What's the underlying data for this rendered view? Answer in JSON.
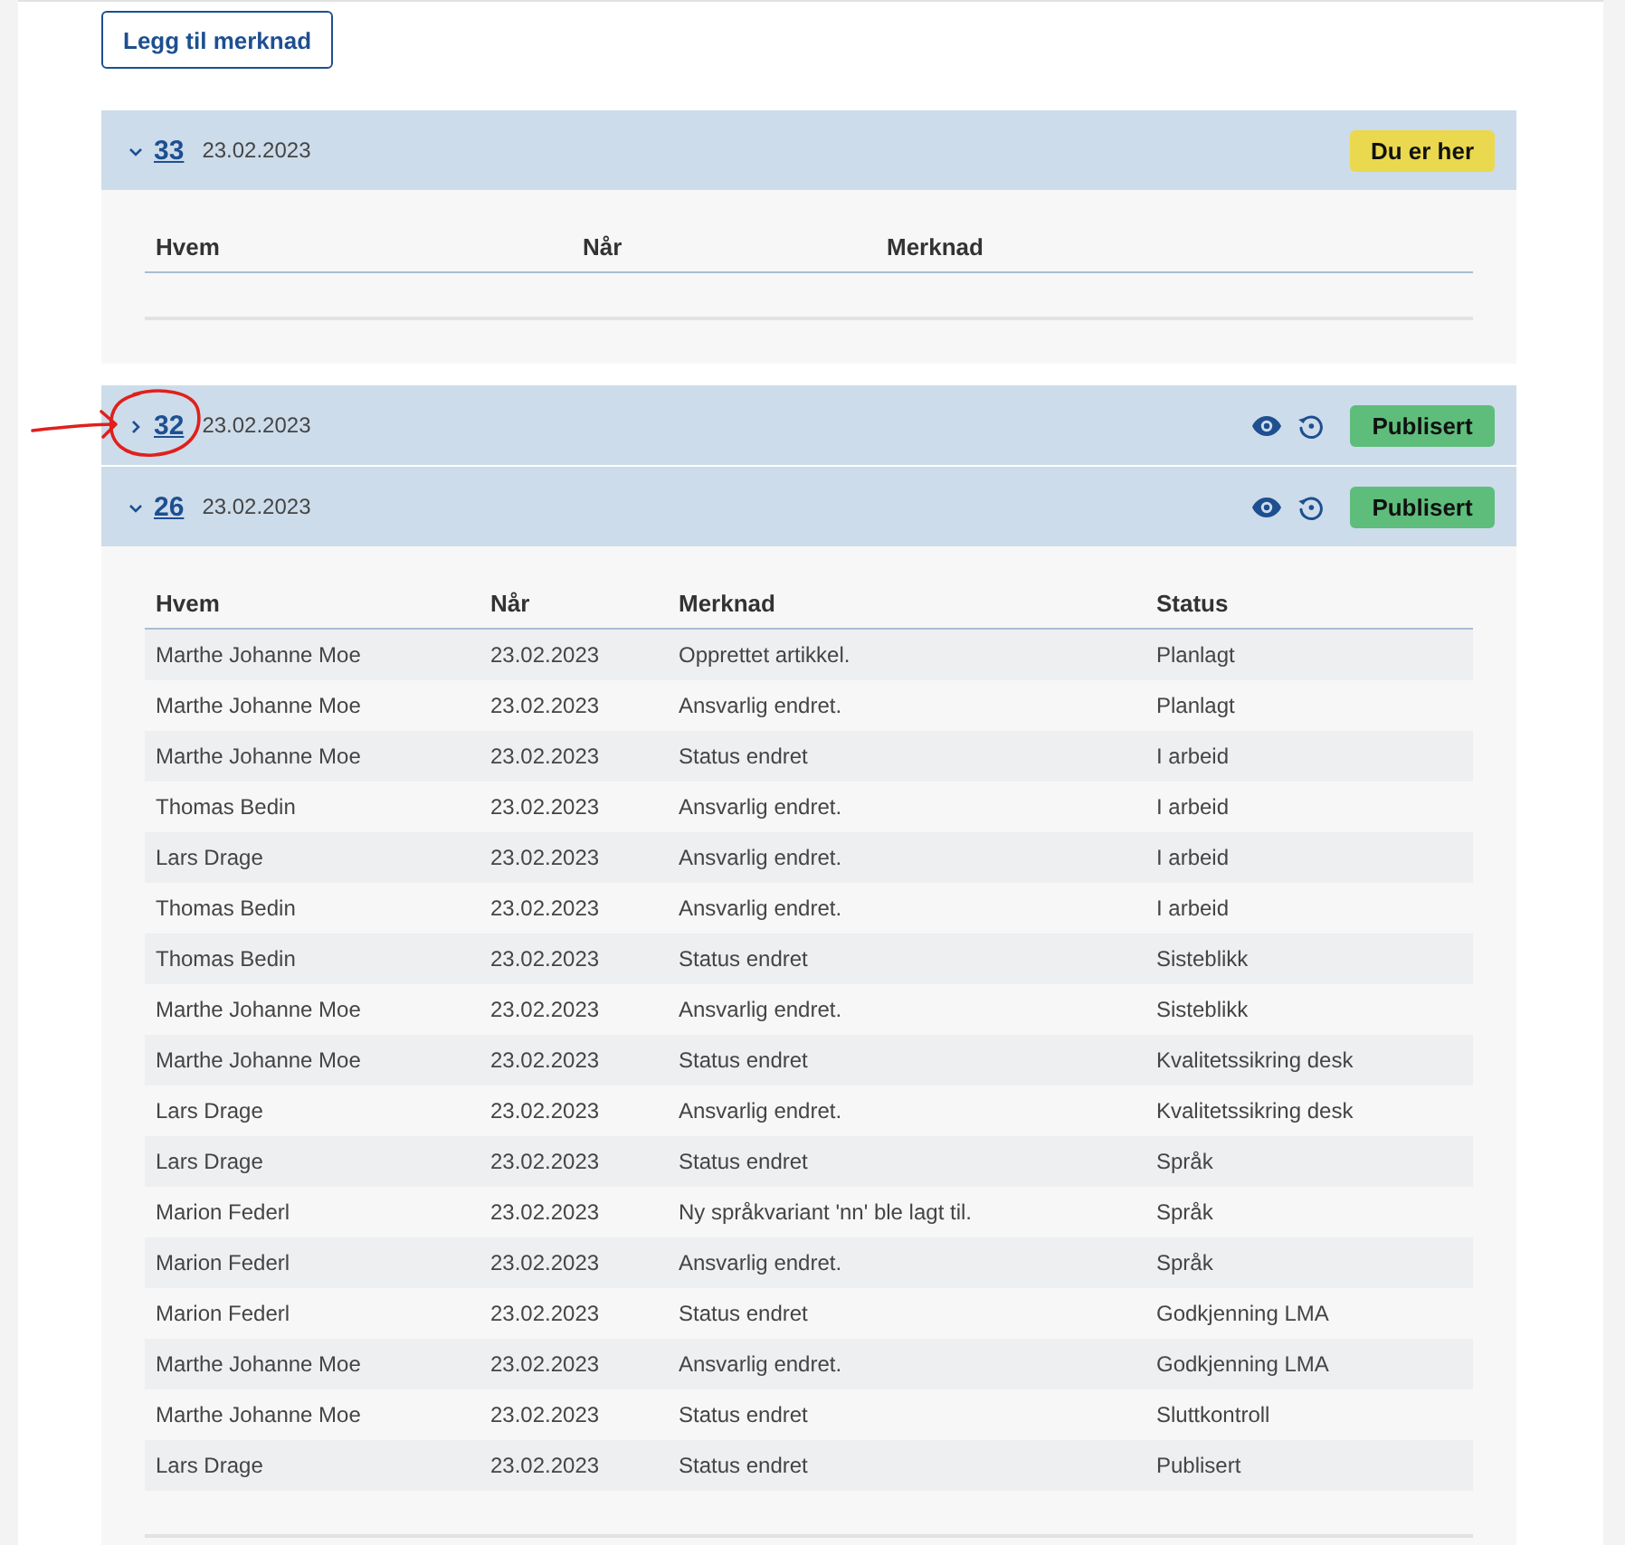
{
  "add_note_button": {
    "label": "Legg til merknad"
  },
  "versions": [
    {
      "number": "33",
      "date": "23.02.2023",
      "expanded": true,
      "annotated": false,
      "show_actions": false,
      "badge": {
        "kind": "current",
        "label": "Du er her"
      },
      "table": {
        "columns": [
          "Hvem",
          "Når",
          "Merknad"
        ]
      }
    },
    {
      "number": "32",
      "date": "23.02.2023",
      "expanded": false,
      "annotated": true,
      "show_actions": true,
      "badge": {
        "kind": "published",
        "label": "Publisert"
      }
    },
    {
      "number": "26",
      "date": "23.02.2023",
      "expanded": true,
      "annotated": false,
      "show_actions": true,
      "badge": {
        "kind": "published",
        "label": "Publisert"
      },
      "table": {
        "columns": [
          "Hvem",
          "Når",
          "Merknad",
          "Status"
        ],
        "rows": [
          [
            "Marthe Johanne Moe",
            "23.02.2023",
            "Opprettet artikkel.",
            "Planlagt"
          ],
          [
            "Marthe Johanne Moe",
            "23.02.2023",
            "Ansvarlig endret.",
            "Planlagt"
          ],
          [
            "Marthe Johanne Moe",
            "23.02.2023",
            "Status endret",
            "I arbeid"
          ],
          [
            "Thomas Bedin",
            "23.02.2023",
            "Ansvarlig endret.",
            "I arbeid"
          ],
          [
            "Lars Drage",
            "23.02.2023",
            "Ansvarlig endret.",
            "I arbeid"
          ],
          [
            "Thomas Bedin",
            "23.02.2023",
            "Ansvarlig endret.",
            "I arbeid"
          ],
          [
            "Thomas Bedin",
            "23.02.2023",
            "Status endret",
            "Sisteblikk"
          ],
          [
            "Marthe Johanne Moe",
            "23.02.2023",
            "Ansvarlig endret.",
            "Sisteblikk"
          ],
          [
            "Marthe Johanne Moe",
            "23.02.2023",
            "Status endret",
            "Kvalitetssikring desk"
          ],
          [
            "Lars Drage",
            "23.02.2023",
            "Ansvarlig endret.",
            "Kvalitetssikring desk"
          ],
          [
            "Lars Drage",
            "23.02.2023",
            "Status endret",
            "Språk"
          ],
          [
            "Marion Federl",
            "23.02.2023",
            "Ny språkvariant 'nn' ble lagt til.",
            "Språk"
          ],
          [
            "Marion Federl",
            "23.02.2023",
            "Ansvarlig endret.",
            "Språk"
          ],
          [
            "Marion Federl",
            "23.02.2023",
            "Status endret",
            "Godkjenning LMA"
          ],
          [
            "Marthe Johanne Moe",
            "23.02.2023",
            "Ansvarlig endret.",
            "Godkjenning LMA"
          ],
          [
            "Marthe Johanne Moe",
            "23.02.2023",
            "Status endret",
            "Sluttkontroll"
          ],
          [
            "Lars Drage",
            "23.02.2023",
            "Status endret",
            "Publisert"
          ]
        ]
      }
    }
  ]
}
